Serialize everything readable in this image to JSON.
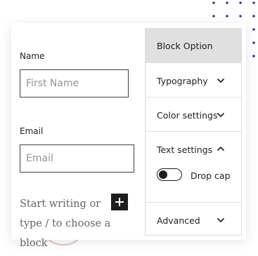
{
  "form": {
    "name_label": "Name",
    "name_placeholder": "First Name",
    "email_label": "Email",
    "email_placeholder": "Email",
    "block_prompt": "Start writing or type / to choose a block",
    "add_block_icon": "plus-icon"
  },
  "settings_panel": {
    "header": "Block Option",
    "sections": {
      "typography": {
        "label": "Typography",
        "expanded": false,
        "icon": "chevron-down-icon"
      },
      "color_settings": {
        "label": "Color settings",
        "expanded": false,
        "icon": "chevron-down-icon"
      },
      "text_settings": {
        "label": "Text settings",
        "expanded": true,
        "icon": "chevron-up-icon"
      },
      "advanced": {
        "label": "Advanced",
        "expanded": false,
        "icon": "chevron-down-icon"
      }
    },
    "drop_cap": {
      "label": "Drop cap",
      "enabled": false
    }
  },
  "colors": {
    "accent_dots": "#1a1a8c",
    "accent_circles": "#f5c6c6",
    "panel_header_bg": "#e0e0e0",
    "text": "#1e1e1e"
  }
}
